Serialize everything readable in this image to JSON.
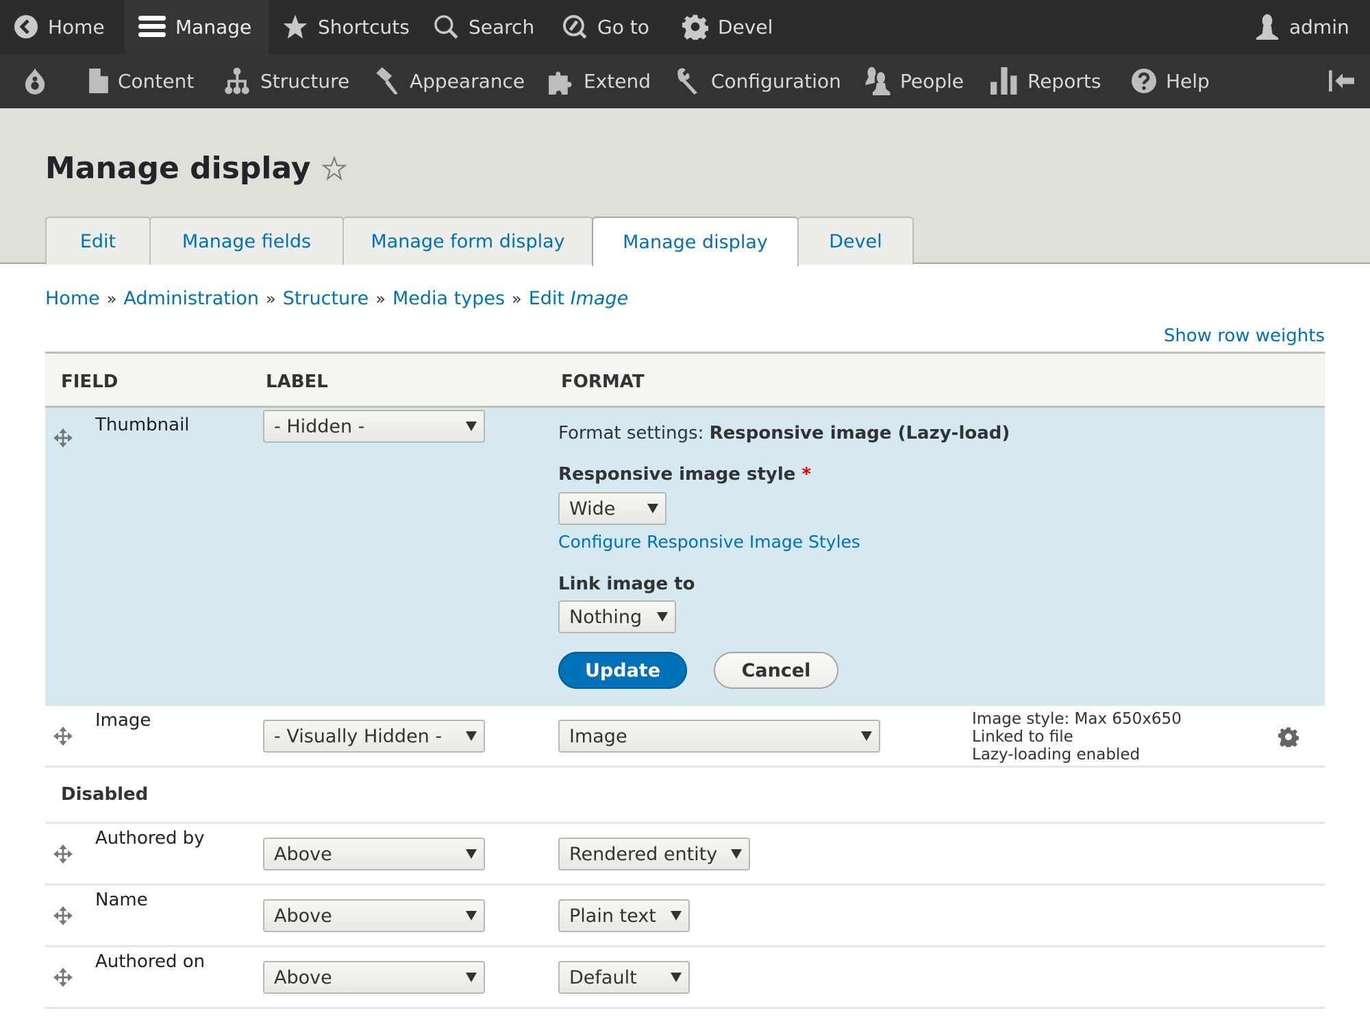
{
  "toolbar": {
    "items": [
      {
        "label": "Home",
        "icon": "home-back-icon"
      },
      {
        "label": "Manage",
        "icon": "hamburger-icon",
        "active": true
      },
      {
        "label": "Shortcuts",
        "icon": "star-icon"
      },
      {
        "label": "Search",
        "icon": "search-icon"
      },
      {
        "label": "Go to",
        "icon": "goto-icon"
      },
      {
        "label": "Devel",
        "icon": "gear-icon"
      }
    ],
    "user": {
      "label": "admin",
      "icon": "user-icon"
    }
  },
  "tray": {
    "items": [
      {
        "label": "Content",
        "icon": "file-icon"
      },
      {
        "label": "Structure",
        "icon": "sitemap-icon"
      },
      {
        "label": "Appearance",
        "icon": "brush-icon"
      },
      {
        "label": "Extend",
        "icon": "puzzle-icon"
      },
      {
        "label": "Configuration",
        "icon": "wrench-icon"
      },
      {
        "label": "People",
        "icon": "people-icon"
      },
      {
        "label": "Reports",
        "icon": "bar-chart-icon"
      },
      {
        "label": "Help",
        "icon": "help-icon"
      }
    ]
  },
  "header": {
    "title": "Manage display",
    "tabs": [
      {
        "label": "Edit"
      },
      {
        "label": "Manage fields"
      },
      {
        "label": "Manage form display"
      },
      {
        "label": "Manage display",
        "active": true
      },
      {
        "label": "Devel"
      }
    ]
  },
  "breadcrumb": {
    "items": [
      "Home",
      "Administration",
      "Structure",
      "Media types"
    ],
    "last_prefix": "Edit",
    "last_emph": "Image",
    "separator": "»"
  },
  "show_row_weights": "Show row weights",
  "table": {
    "headers": {
      "field": "FIELD",
      "label": "LABEL",
      "format": "FORMAT"
    },
    "thumbnail": {
      "name": "Thumbnail",
      "label_value": "- Hidden -",
      "format_settings_prefix": "Format settings:",
      "format_settings_name": "Responsive image (Lazy-load)",
      "style_label": "Responsive image style",
      "required_mark": "*",
      "style_value": "Wide",
      "configure_link": "Configure Responsive Image Styles",
      "link_label": "Link image to",
      "link_value": "Nothing",
      "update": "Update",
      "cancel": "Cancel"
    },
    "image": {
      "name": "Image",
      "label_value": "- Visually Hidden -",
      "format_value": "Image",
      "summary": [
        "Image style: Max 650x650",
        "Linked to file",
        "Lazy-loading enabled"
      ]
    },
    "disabled_heading": "Disabled",
    "disabled_rows": [
      {
        "name": "Authored by",
        "label_value": "Above",
        "format_value": "Rendered entity"
      },
      {
        "name": "Name",
        "label_value": "Above",
        "format_value": "Plain text"
      },
      {
        "name": "Authored on",
        "label_value": "Above",
        "format_value": "Default"
      }
    ]
  },
  "colors": {
    "accent": "#0071b8",
    "highlight_row": "#d6e8f0",
    "toolbar": "#2c2c2c",
    "required": "#e00000"
  }
}
